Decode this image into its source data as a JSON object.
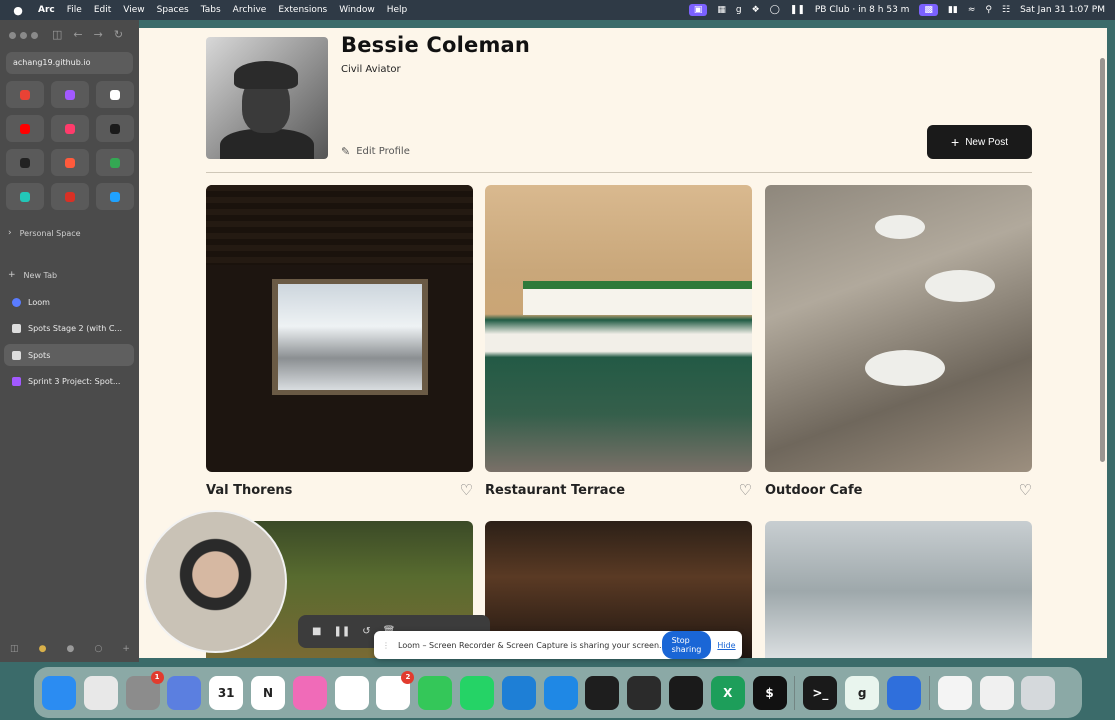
{
  "menubar": {
    "app": "Arc",
    "menus": [
      "File",
      "Edit",
      "View",
      "Spaces",
      "Tabs",
      "Archive",
      "Extensions",
      "Window",
      "Help"
    ],
    "status": "PB Club · in 8 h 53 m",
    "datetime": "Sat Jan 31  1:07 PM"
  },
  "sidebar": {
    "url": "achang19.github.io",
    "favorites": [
      {
        "icon": "google-icon",
        "color": "#e94235"
      },
      {
        "icon": "figma-icon",
        "color": "#a259ff"
      },
      {
        "icon": "github-icon",
        "color": "#ffffff"
      },
      {
        "icon": "youtube-icon",
        "color": "#ff0000"
      },
      {
        "icon": "record-icon",
        "color": "#ff3b6b"
      },
      {
        "icon": "discord-icon",
        "color": "#1a1a1a"
      },
      {
        "icon": "openai-icon",
        "color": "#222222"
      },
      {
        "icon": "loom-icon",
        "color": "#ff5a3c"
      },
      {
        "icon": "meet-icon",
        "color": "#34a853"
      },
      {
        "icon": "codepen-icon",
        "color": "#22c7b8"
      },
      {
        "icon": "tool-icon",
        "color": "#d93025"
      },
      {
        "icon": "canva-icon",
        "color": "#1fa2ff"
      }
    ],
    "space_label": "Personal Space",
    "new_tab": "New Tab",
    "tabs": [
      {
        "label": "Loom",
        "color": "#5a7cff"
      },
      {
        "label": "Spots Stage 2 (with C...",
        "color": "#dddddd"
      },
      {
        "label": "Spots",
        "color": "#dddddd"
      },
      {
        "label": "Sprint 3 Project: Spot...",
        "color": "#a259ff"
      }
    ]
  },
  "profile": {
    "name": "Bessie Coleman",
    "role": "Civil Aviator",
    "edit_label": "Edit Profile",
    "new_post_label": "New Post"
  },
  "cards": [
    {
      "title": "Val Thorens"
    },
    {
      "title": "Restaurant Terrace"
    },
    {
      "title": "Outdoor Cafe"
    }
  ],
  "loom_banner": {
    "message": "Loom – Screen Recorder & Screen Capture is sharing your screen.",
    "stop": "Stop sharing",
    "hide": "Hide"
  },
  "dock": [
    {
      "icon": "finder-icon",
      "color": "#2b8cf2",
      "glyph": ""
    },
    {
      "icon": "launchpad-icon",
      "color": "#e8e8e8",
      "glyph": ""
    },
    {
      "icon": "system-settings-icon",
      "color": "#8c8c8c",
      "glyph": "",
      "badge": "1"
    },
    {
      "icon": "simulator-icon",
      "color": "#5b7fe0",
      "glyph": ""
    },
    {
      "icon": "calendar-icon",
      "color": "#ffffff",
      "glyph": "31"
    },
    {
      "icon": "notion-icon",
      "color": "#ffffff",
      "glyph": "N"
    },
    {
      "icon": "pinwheel-icon",
      "color": "#f06bb8",
      "glyph": ""
    },
    {
      "icon": "chrome-icon",
      "color": "#ffffff",
      "glyph": ""
    },
    {
      "icon": "slack-icon",
      "color": "#ffffff",
      "glyph": "",
      "badge": "2"
    },
    {
      "icon": "messages-icon",
      "color": "#34c759",
      "glyph": ""
    },
    {
      "icon": "whatsapp-icon",
      "color": "#25d366",
      "glyph": ""
    },
    {
      "icon": "vscode-icon",
      "color": "#1e7fd6",
      "glyph": ""
    },
    {
      "icon": "affinity-icon",
      "color": "#1f88e5",
      "glyph": ""
    },
    {
      "icon": "figma-icon",
      "color": "#1e1e1e",
      "glyph": ""
    },
    {
      "icon": "arc-ring-icon",
      "color": "#2b2b2b",
      "glyph": ""
    },
    {
      "icon": "arc-icon",
      "color": "#1a1a1a",
      "glyph": ""
    },
    {
      "icon": "excel-icon",
      "color": "#1d9e5a",
      "glyph": "X"
    },
    {
      "icon": "dollar-icon",
      "color": "#111111",
      "glyph": "$"
    },
    {
      "icon": "terminal-icon",
      "color": "#1a1a1a",
      "glyph": ">_"
    },
    {
      "icon": "grammarly-icon",
      "color": "#e9f5ee",
      "glyph": "g"
    },
    {
      "icon": "disk-utility-icon",
      "color": "#2f6fdc",
      "glyph": ""
    },
    {
      "icon": "document-icon",
      "color": "#f4f4f4",
      "glyph": ""
    },
    {
      "icon": "screen-icon",
      "color": "#f0f0f0",
      "glyph": ""
    },
    {
      "icon": "trash-icon",
      "color": "#d5d9dc",
      "glyph": ""
    }
  ]
}
